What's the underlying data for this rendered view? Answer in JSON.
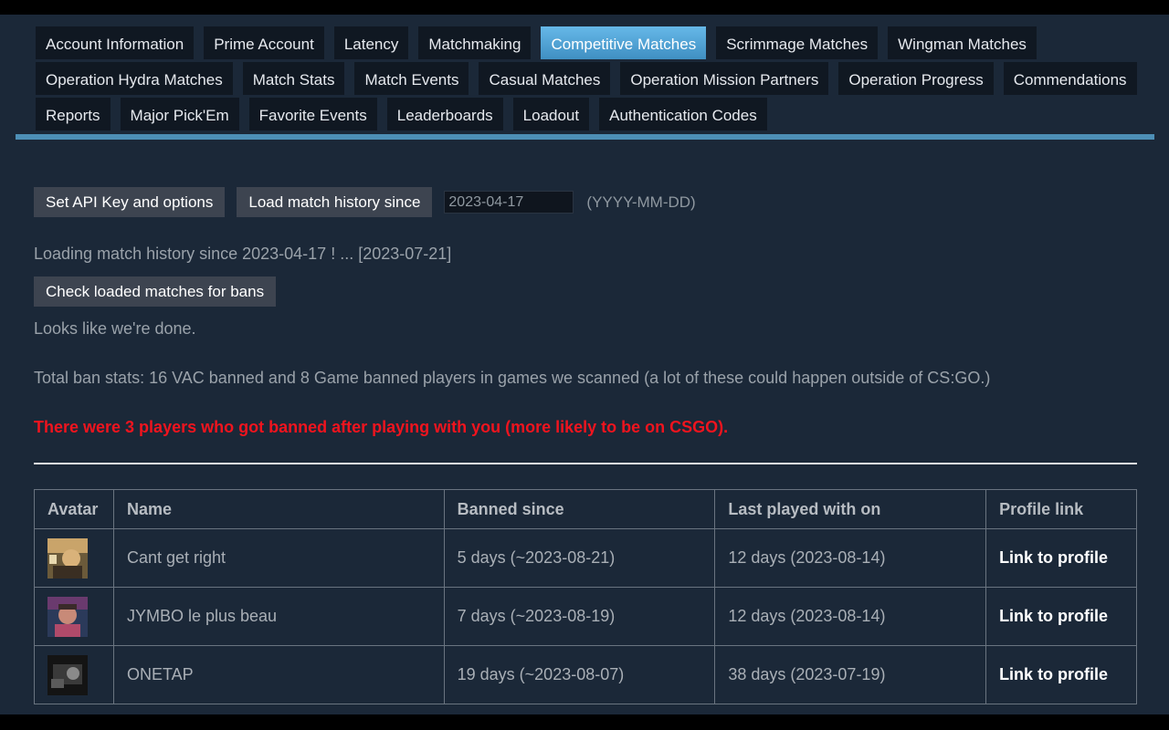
{
  "tabs": {
    "row1": [
      "Account Information",
      "Prime Account",
      "Latency",
      "Matchmaking",
      "Competitive Matches",
      "Scrimmage Matches",
      "Wingman Matches"
    ],
    "row2": [
      "Operation Hydra Matches",
      "Match Stats",
      "Match Events",
      "Casual Matches",
      "Operation Mission Partners",
      "Operation Progress",
      "Commendations"
    ],
    "row3": [
      "Reports",
      "Major Pick'Em",
      "Favorite Events",
      "Leaderboards",
      "Loadout",
      "Authentication Codes"
    ],
    "active": "Competitive Matches"
  },
  "controls": {
    "api_button": "Set API Key and options",
    "load_button": "Load match history since",
    "date_value": "2023-04-17",
    "date_hint": "(YYYY-MM-DD)",
    "check_button": "Check loaded matches for bans"
  },
  "status": {
    "loading": "Loading match history since 2023-04-17 ! ... [2023-07-21]",
    "done": "Looks like we're done.",
    "totals": "Total ban stats: 16 VAC banned and 8 Game banned players in games we scanned (a lot of these could happen outside of CS:GO.)",
    "alert": "There were 3 players who got banned after playing with you (more likely to be on CSGO)."
  },
  "table": {
    "headers": {
      "avatar": "Avatar",
      "name": "Name",
      "banned": "Banned since",
      "last": "Last played with on",
      "profile": "Profile link"
    },
    "rows": [
      {
        "name": "Cant get right",
        "banned": "5 days (~2023-08-21)",
        "last": "12 days (2023-08-14)",
        "profile": "Link to profile"
      },
      {
        "name": "JYMBO le plus beau",
        "banned": "7 days (~2023-08-19)",
        "last": "12 days (2023-08-14)",
        "profile": "Link to profile"
      },
      {
        "name": "ONETAP",
        "banned": "19 days (~2023-08-07)",
        "last": "38 days (2023-07-19)",
        "profile": "Link to profile"
      }
    ]
  },
  "colors": {
    "background": "#1b2838",
    "tab": "#101822",
    "tab_active": "#4fa3d6",
    "alert": "#f0141e",
    "button": "#3d4450"
  }
}
